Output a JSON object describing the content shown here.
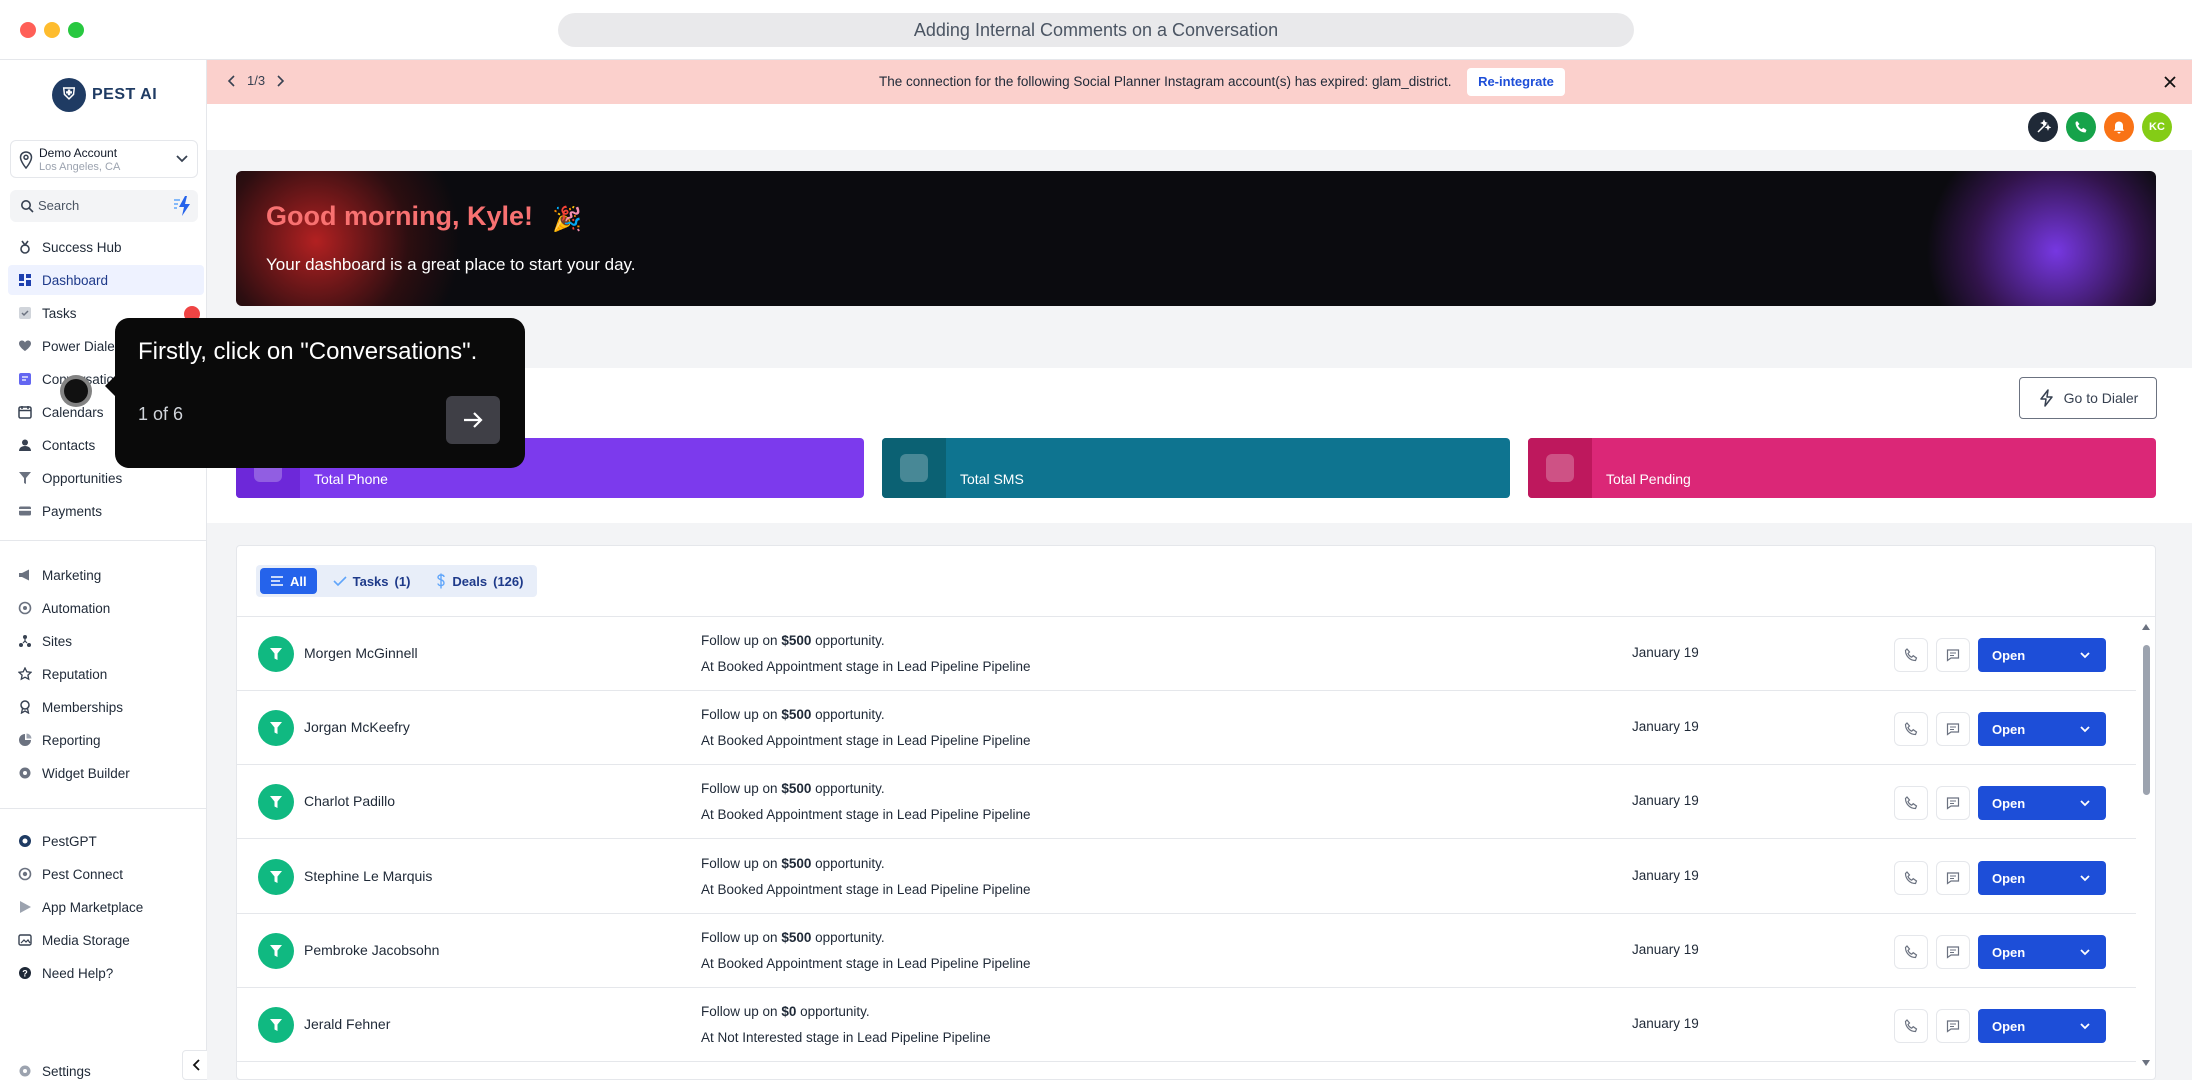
{
  "window": {
    "title": "Adding Internal Comments on a Conversation"
  },
  "logo": {
    "text": "PEST AI"
  },
  "account": {
    "name": "Demo Account",
    "location": "Los Angeles, CA"
  },
  "search": {
    "placeholder": "Search"
  },
  "sidebar": {
    "items": [
      {
        "label": "Success Hub",
        "icon": "medal-icon"
      },
      {
        "label": "Dashboard",
        "icon": "dashboard-icon"
      },
      {
        "label": "Tasks",
        "icon": "check-square-icon"
      },
      {
        "label": "Power Dialer",
        "icon": "heart-icon"
      },
      {
        "label": "Conversations",
        "icon": "chat-icon"
      },
      {
        "label": "Calendars",
        "icon": "calendar-icon"
      },
      {
        "label": "Contacts",
        "icon": "person-icon"
      },
      {
        "label": "Opportunities",
        "icon": "funnel-icon"
      },
      {
        "label": "Payments",
        "icon": "card-icon"
      }
    ],
    "items2": [
      {
        "label": "Marketing",
        "icon": "megaphone-icon"
      },
      {
        "label": "Automation",
        "icon": "automation-icon"
      },
      {
        "label": "Sites",
        "icon": "sites-icon"
      },
      {
        "label": "Reputation",
        "icon": "star-icon"
      },
      {
        "label": "Memberships",
        "icon": "membership-icon"
      },
      {
        "label": "Reporting",
        "icon": "chart-icon"
      },
      {
        "label": "Widget Builder",
        "icon": "widget-icon"
      }
    ],
    "items3": [
      {
        "label": "PestGPT",
        "icon": "gpt-icon"
      },
      {
        "label": "Pest Connect",
        "icon": "connect-icon"
      },
      {
        "label": "App Marketplace",
        "icon": "marketplace-icon"
      },
      {
        "label": "Media Storage",
        "icon": "media-icon"
      },
      {
        "label": "Need Help?",
        "icon": "help-icon"
      }
    ],
    "settings": "Settings"
  },
  "banner": {
    "pager": "1/3",
    "message": "The connection for the following Social Planner Instagram account(s) has expired: glam_district.",
    "action": "Re-integrate"
  },
  "topbar": {
    "avatar_initials": "KC"
  },
  "hero": {
    "greeting": "Good morning, Kyle!",
    "emoji": "🎉",
    "subtitle": "Your dashboard is a great place to start your day."
  },
  "dialer": {
    "goto_label": "Go to Dialer",
    "stats": [
      {
        "label": "Total Phone",
        "color": "#7c3aed",
        "icon_bg": "#6d28d9"
      },
      {
        "label": "Total SMS",
        "color": "#0e7490",
        "icon_bg": "#0b6173"
      },
      {
        "label": "Total Pending",
        "color": "#db2777",
        "icon_bg": "#be185d"
      }
    ]
  },
  "filters": {
    "all": "All",
    "tasks": "Tasks",
    "tasks_count": "(1)",
    "deals": "Deals",
    "deals_count": "(126)"
  },
  "rows": [
    {
      "name": "Morgen McGinnell",
      "prefix": "Follow up on",
      "amount": "$500",
      "suffix": "opportunity.",
      "stage": "At Booked Appointment stage in Lead Pipeline Pipeline",
      "date": "January 19",
      "action": "Open"
    },
    {
      "name": "Jorgan McKeefry",
      "prefix": "Follow up on",
      "amount": "$500",
      "suffix": "opportunity.",
      "stage": "At Booked Appointment stage in Lead Pipeline Pipeline",
      "date": "January 19",
      "action": "Open"
    },
    {
      "name": "Charlot Padillo",
      "prefix": "Follow up on",
      "amount": "$500",
      "suffix": "opportunity.",
      "stage": "At Booked Appointment stage in Lead Pipeline Pipeline",
      "date": "January 19",
      "action": "Open"
    },
    {
      "name": "Stephine Le Marquis",
      "prefix": "Follow up on",
      "amount": "$500",
      "suffix": "opportunity.",
      "stage": "At Booked Appointment stage in Lead Pipeline Pipeline",
      "date": "January 19",
      "action": "Open"
    },
    {
      "name": "Pembroke Jacobsohn",
      "prefix": "Follow up on",
      "amount": "$500",
      "suffix": "opportunity.",
      "stage": "At Booked Appointment stage in Lead Pipeline Pipeline",
      "date": "January 19",
      "action": "Open"
    },
    {
      "name": "Jerald Fehner",
      "prefix": "Follow up on",
      "amount": "$0",
      "suffix": "opportunity.",
      "stage": "At Not Interested stage in Lead Pipeline Pipeline",
      "date": "January 19",
      "action": "Open"
    }
  ],
  "tooltip": {
    "text": "Firstly, click on \"Conversations\".",
    "step": "1 of 6"
  }
}
